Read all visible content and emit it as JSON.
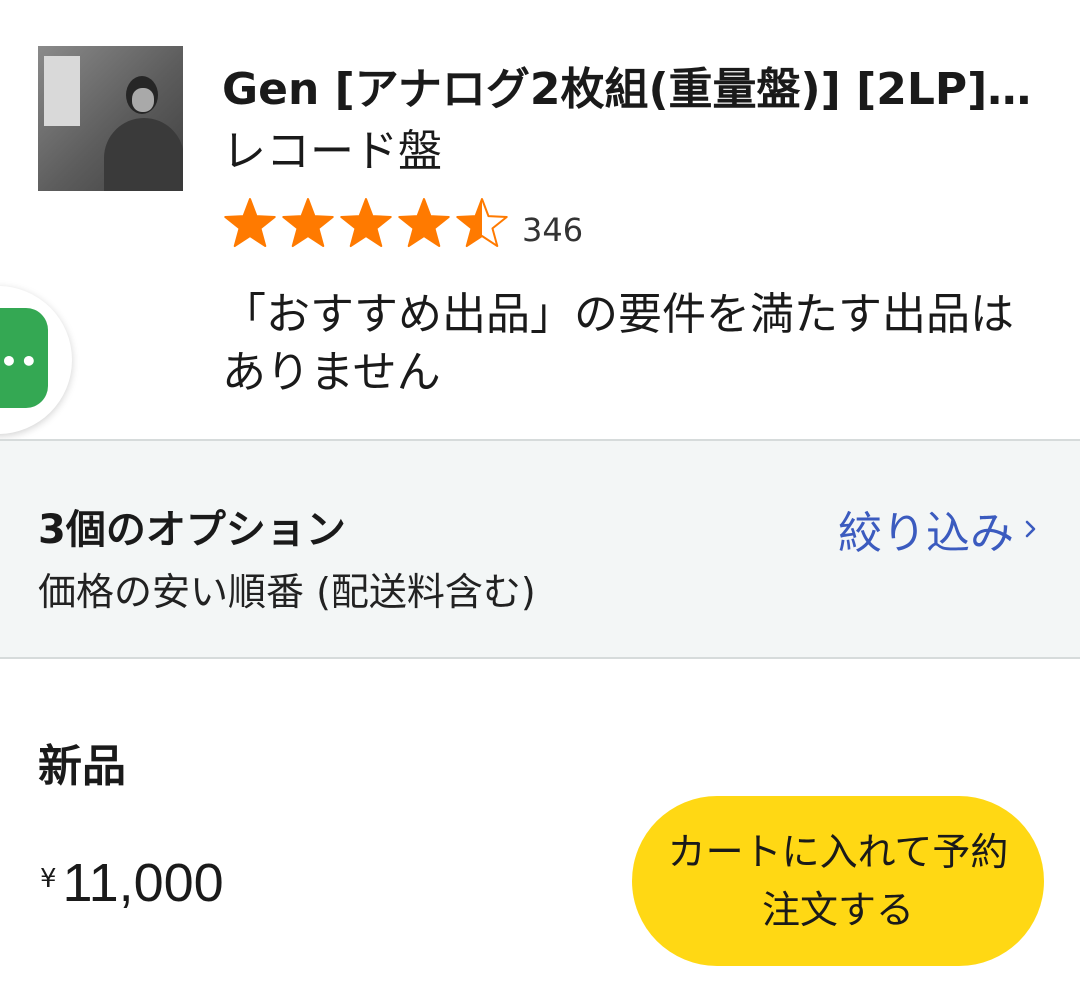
{
  "product": {
    "title": "Gen [アナログ2枚組(重量盤)] [2LP] …",
    "format": "レコード盤",
    "thumbnail_icon": "album-cover-photo",
    "rating": {
      "value": 4.5,
      "max": 5,
      "count": "346",
      "star_color": "#ff7a00"
    }
  },
  "notice": {
    "no_featured_offer": "「おすすめ出品」の要件を満たす出品はありません"
  },
  "chat_button": {
    "icon": "chat-dots-icon",
    "color": "#34a853"
  },
  "options": {
    "count_label": "3個のオプション",
    "sort_label": "価格の安い順番 (配送料含む)",
    "filter_label": "絞り込み",
    "filter_color": "#3b5bbf"
  },
  "offer": {
    "condition": "新品",
    "currency": "¥",
    "price": "11,000",
    "cart_button_label": "カートに入れて予約注文する",
    "cart_button_color": "#ffd814"
  }
}
